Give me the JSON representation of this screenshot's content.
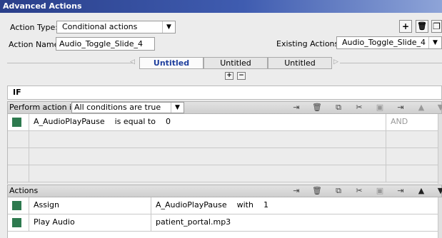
{
  "window": {
    "title": "Advanced Actions"
  },
  "form": {
    "action_type_label": "Action Type:",
    "action_type_value": "Conditional actions",
    "action_name_label": "Action Name:",
    "action_name_value": "Audio_Toggle_Slide_4",
    "existing_actions_label": "Existing Actions:",
    "existing_actions_value": "Audio_Toggle_Slide_4"
  },
  "toolbar_icons": [
    "add-icon",
    "trash-icon",
    "duplicate-icon"
  ],
  "tabs": [
    {
      "label": "Untitled",
      "active": true
    },
    {
      "label": "Untitled",
      "active": false
    },
    {
      "label": "Untitled",
      "active": false
    }
  ],
  "tab_controls": {
    "add": "+",
    "remove": "−"
  },
  "if_section": {
    "header": "IF",
    "perform_label": "Perform action if:",
    "perform_value": "All conditions are true",
    "conditions": [
      {
        "variable": "A_AudioPlayPause",
        "operator": "is equal to",
        "value": "0",
        "logic": "AND"
      }
    ]
  },
  "actions_section": {
    "header": "Actions",
    "rows": [
      {
        "action": "Assign",
        "target": "A_AudioPlayPause",
        "with_label": "with",
        "value": "1"
      },
      {
        "action": "Play Audio",
        "target": "patient_portal.mp3"
      }
    ]
  },
  "colors": {
    "title_bar": "#2a3f8a",
    "active_tab_text": "#1e3f9e",
    "row_marker": "#2e7a4f"
  }
}
